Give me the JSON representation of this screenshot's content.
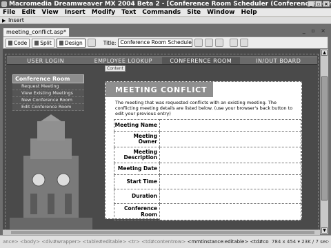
{
  "window": {
    "title": "Macromedia Dreamweaver MX 2004 Beta 2 - [Conference Room Scheduler (ConferenceRoomScheduler_VBS/m..."
  },
  "menu": [
    "File",
    "Edit",
    "View",
    "Insert",
    "Modify",
    "Text",
    "Commands",
    "Site",
    "Window",
    "Help"
  ],
  "insert_bar": {
    "label": "Insert"
  },
  "document": {
    "tab_label": "meeting_conflict.asp*",
    "toolbar": {
      "code_label": "Code",
      "split_label": "Split",
      "design_label": "Design",
      "title_label": "Title:",
      "title_value": "Conference Room Scheduler"
    }
  },
  "page": {
    "nav": [
      "USER LOGIN",
      "EMPLOYEE LOOKUP",
      "CONFERENCE ROOM",
      "IN/OUT BOARD"
    ],
    "content_tag": "Content",
    "sidenav": {
      "heading": "Conference Room",
      "items": [
        "Request Meeting",
        "View Existing Meetings",
        "New Conference Room",
        "Edit Conference Room"
      ]
    },
    "main": {
      "heading": "MEETING CONFLICT",
      "intro": "The meeting that was requested conflicts with an existing meeting. The conflicting meeting details are listed below. (use your browser's back button to edit your previous entry)",
      "rows": [
        {
          "line1": "Meeting Name",
          "line2": ""
        },
        {
          "line1": "Meeting",
          "line2": "Owner"
        },
        {
          "line1": "Meeting",
          "line2": "Description"
        },
        {
          "line1": "Meeting Date",
          "line2": ""
        },
        {
          "line1": "Start Time",
          "line2": ""
        },
        {
          "line1": "Duration",
          "line2": ""
        },
        {
          "line1": "Conference",
          "line2": "Room"
        }
      ]
    }
  },
  "status": {
    "tag_path_faded": "ance> <body> <div#wrapper> <table#editable> <tr> <td#contentrow>",
    "tag_path": "<mmtinstance:editable> <td#contentcell> <table> <tr> <td>",
    "dimensions": "784 x 454",
    "size_time": "23K / 7 sec"
  },
  "colors": {
    "canvas_bg": "#4a4a4a",
    "nav_bg": "#6a6a6a",
    "heading_bg": "#8e8e8e"
  }
}
